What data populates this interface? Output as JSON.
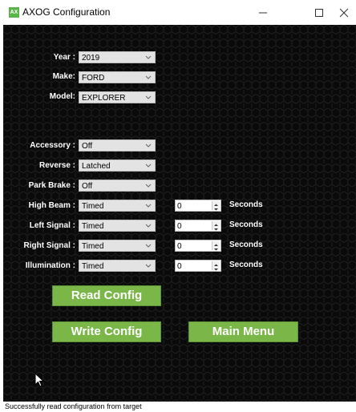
{
  "window": {
    "title": "AXOG Configuration",
    "icon_text": "AX",
    "controls": [
      "minimize-icon",
      "maximize-icon",
      "close-icon"
    ]
  },
  "colors": {
    "background": "#0d0d0d",
    "button_green": "#7ab648",
    "label_text": "#ffffff"
  },
  "vehicle": {
    "year": {
      "label": "Year :",
      "value": "2019"
    },
    "make": {
      "label": "Make:",
      "value": "FORD"
    },
    "model": {
      "label": "Model:",
      "value": "EXPLORER"
    }
  },
  "outputs": [
    {
      "label": "Accessory :",
      "mode": "Off"
    },
    {
      "label": "Reverse :",
      "mode": "Latched"
    },
    {
      "label": "Park Brake :",
      "mode": "Off"
    },
    {
      "label": "High Beam :",
      "mode": "Timed",
      "seconds": "0",
      "unit": "Seconds"
    },
    {
      "label": "Left Signal :",
      "mode": "Timed",
      "seconds": "0",
      "unit": "Seconds"
    },
    {
      "label": "Right Signal :",
      "mode": "Timed",
      "seconds": "0",
      "unit": "Seconds"
    },
    {
      "label": "Illumination :",
      "mode": "Timed",
      "seconds": "0",
      "unit": "Seconds"
    }
  ],
  "buttons": {
    "read": "Read Config",
    "write": "Write Config",
    "main_menu": "Main Menu"
  },
  "status": "Successfully read configuration from target"
}
